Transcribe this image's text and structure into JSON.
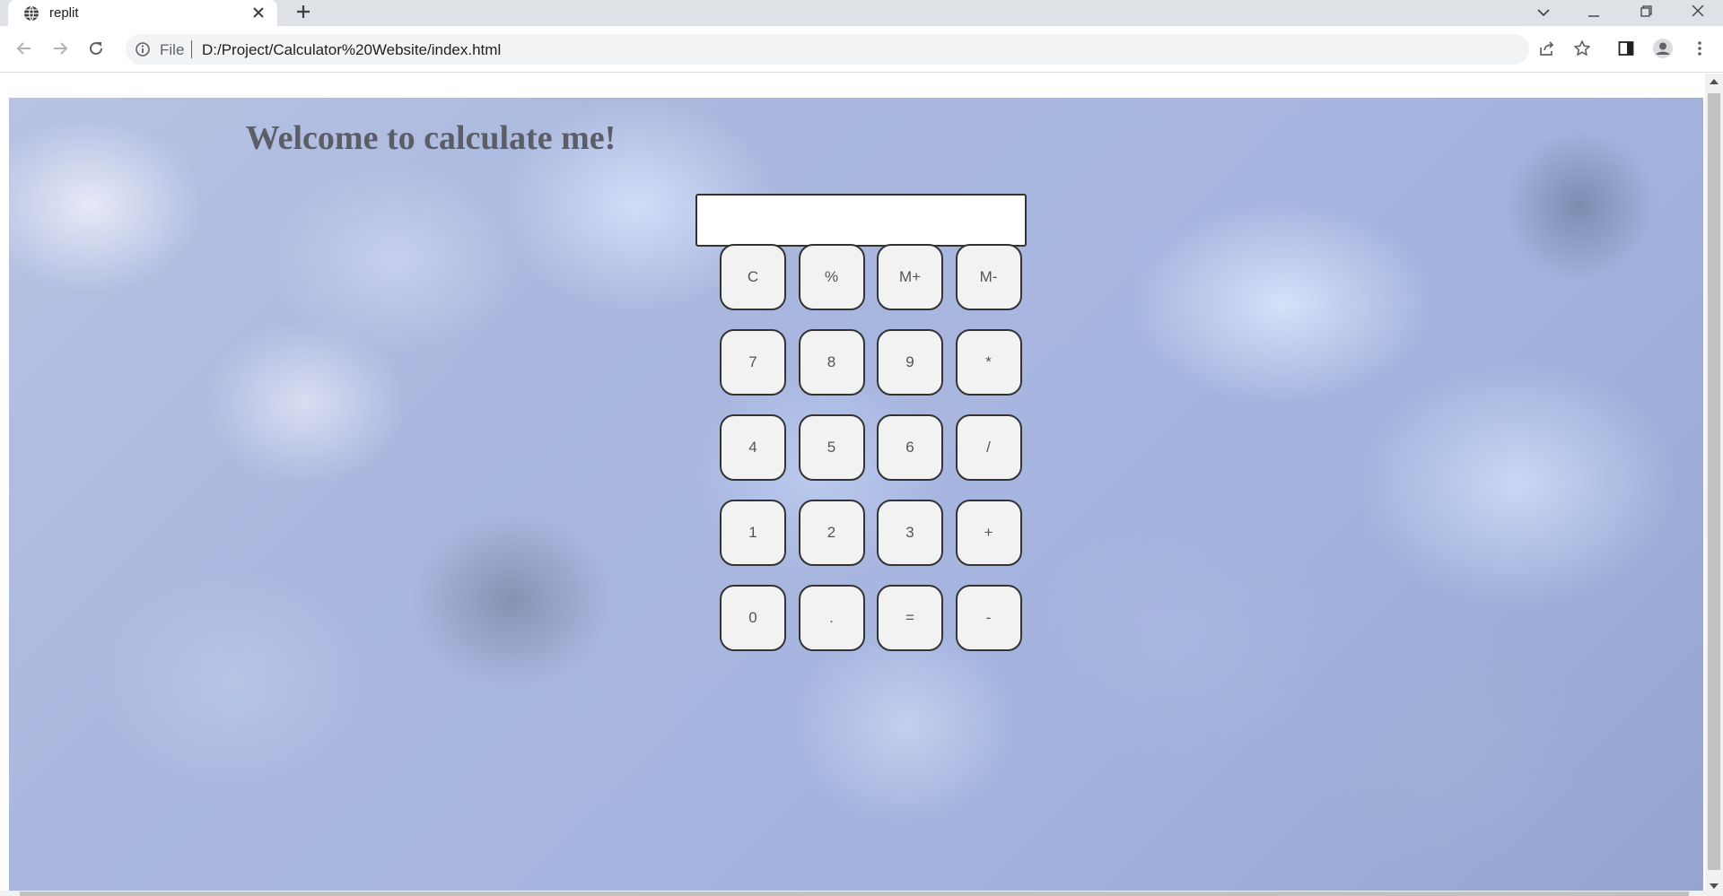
{
  "browser": {
    "tab_title": "replit",
    "tab_icon": "globe-icon",
    "new_tab_icon": "plus-icon",
    "scheme_label": "File",
    "url": "D:/Project/Calculator%20Website/index.html"
  },
  "page": {
    "title": "Welcome to calculate me!",
    "display_value": "",
    "keys": [
      [
        "C",
        "%",
        "M+",
        "M-"
      ],
      [
        "7",
        "8",
        "9",
        "*"
      ],
      [
        "4",
        "5",
        "6",
        "/"
      ],
      [
        "1",
        "2",
        "3",
        "+"
      ],
      [
        "0",
        ".",
        "=",
        "-"
      ]
    ]
  },
  "colors": {
    "key_background": "#f2f2f2",
    "key_border": "#333333",
    "title_color": "#5b5e66"
  }
}
